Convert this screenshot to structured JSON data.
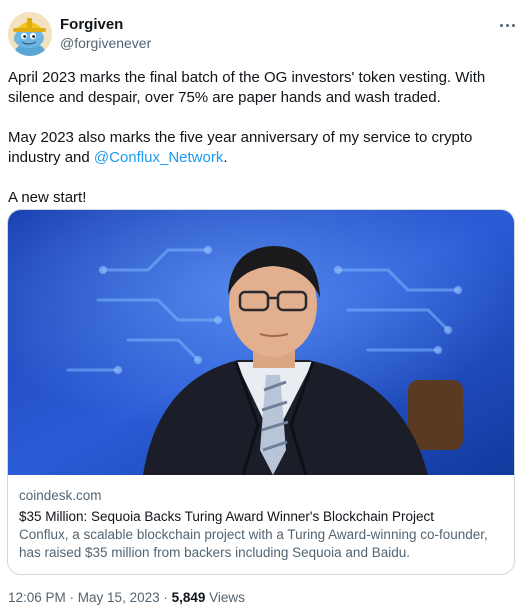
{
  "author": {
    "display_name": "Forgiven",
    "handle": "@forgivenever"
  },
  "icons": {
    "avatar": "blue-cartoon-character-hard-hat-icon",
    "more": "more-options-icon"
  },
  "tweet": {
    "paragraph_1": "April 2023 marks the final batch of the OG investors' token vesting. With silence and despair, over 75% are paper hands and wash traded.",
    "paragraph_2_before": "May 2023 also marks the five year anniversary of my service to crypto industry and ",
    "paragraph_2_mention": "@Conflux_Network",
    "paragraph_2_after": ".",
    "paragraph_3": "A new start!"
  },
  "card": {
    "domain": "coindesk.com",
    "title": "$35 Million: Sequoia Backs Turing Award Winner's Blockchain Project",
    "description": "Conflux, a scalable blockchain project with a Turing Award-winning co-founder, has raised $35 million from backers including Sequoia and Baidu."
  },
  "meta": {
    "time": "12:06 PM",
    "separator_1": " · ",
    "date": "May 15, 2023",
    "separator_2": " · ",
    "views_count": "5,849",
    "views_label": " Views"
  },
  "colors": {
    "link": "#1d9bf0",
    "secondary_text": "#536471",
    "border": "#cfd9de"
  }
}
